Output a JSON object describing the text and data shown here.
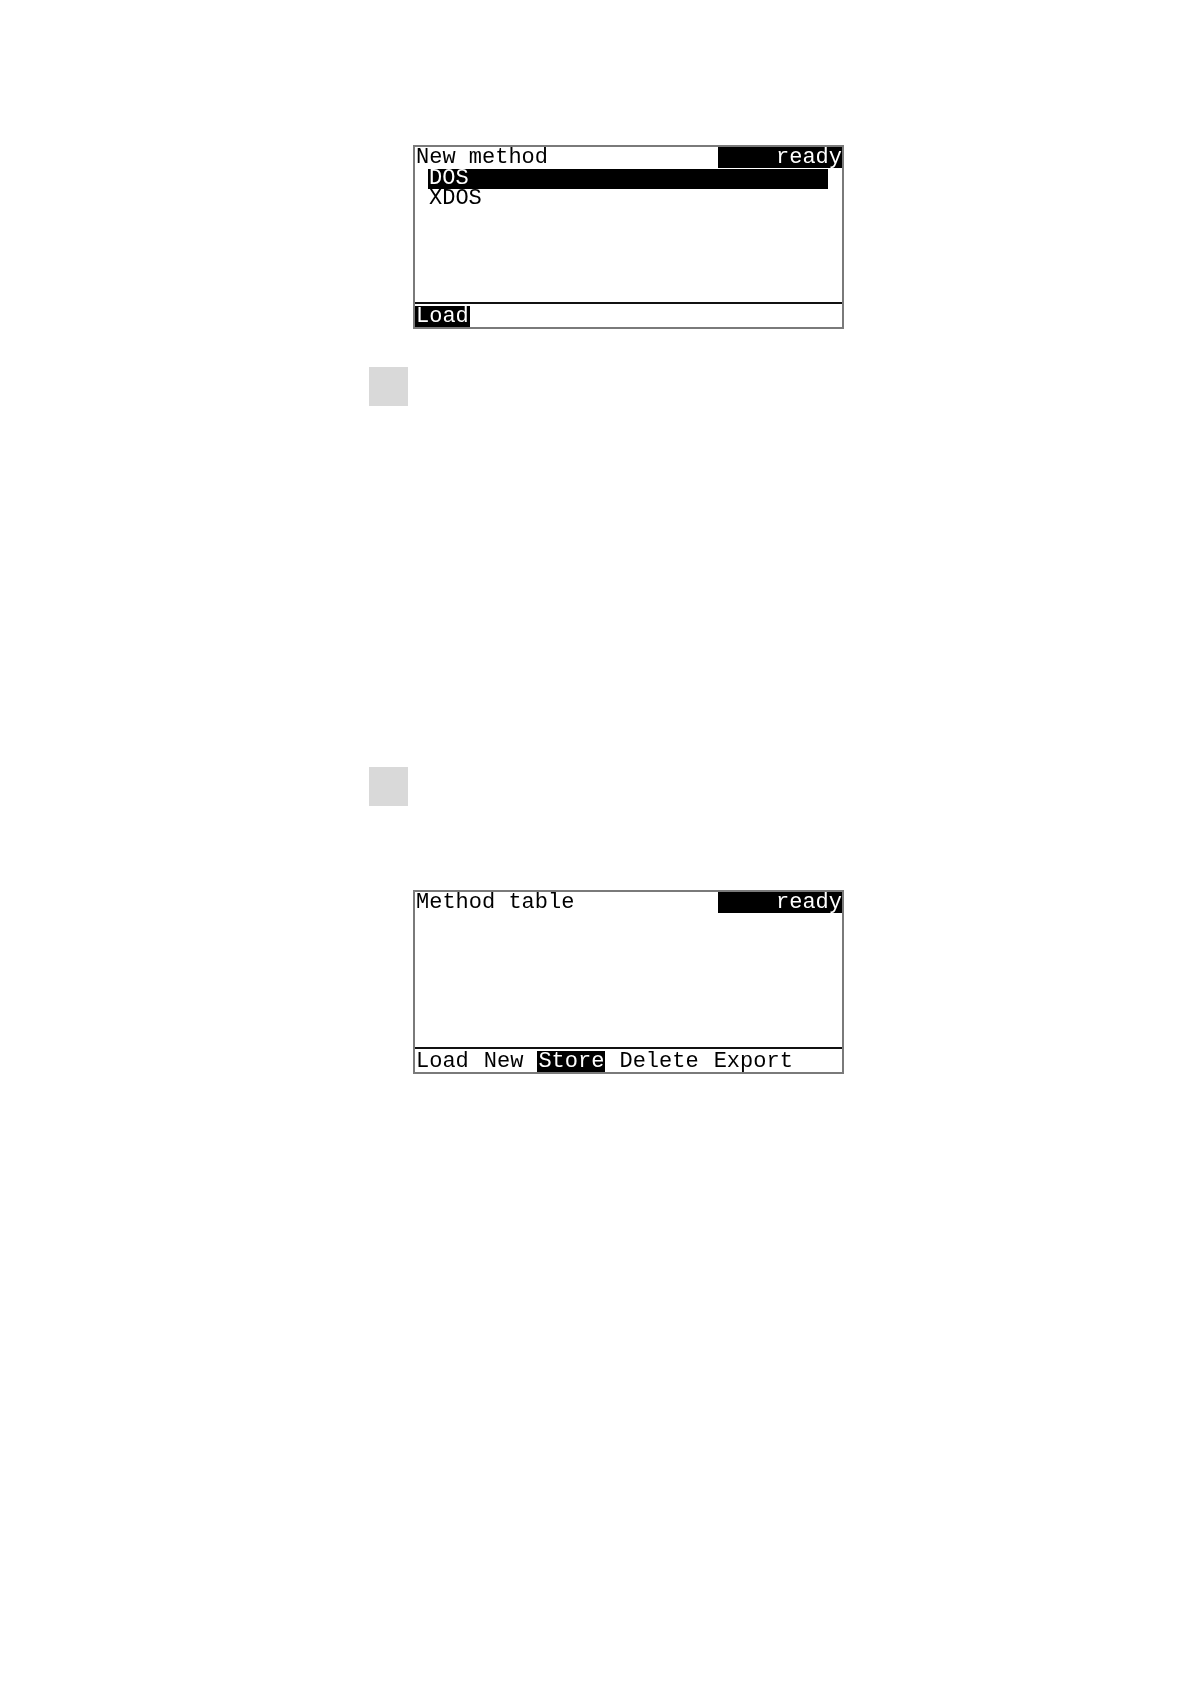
{
  "sections": [
    {
      "kind": "screen",
      "title": "New method",
      "status": "ready",
      "list": [
        {
          "label": "DOS",
          "selected": true
        },
        {
          "label": "XDOS",
          "selected": false
        }
      ],
      "softkeys": [
        {
          "label": "Load",
          "selected": true
        }
      ]
    },
    {
      "kind": "block"
    },
    {
      "kind": "block"
    },
    {
      "kind": "screen",
      "title": "Method table",
      "status": "ready",
      "softkeys": [
        {
          "label": "Load",
          "selected": false
        },
        {
          "label": "New",
          "selected": false
        },
        {
          "label": "Store",
          "selected": true
        },
        {
          "label": "Delete",
          "selected": false
        },
        {
          "label": "Export",
          "selected": false
        }
      ]
    }
  ]
}
